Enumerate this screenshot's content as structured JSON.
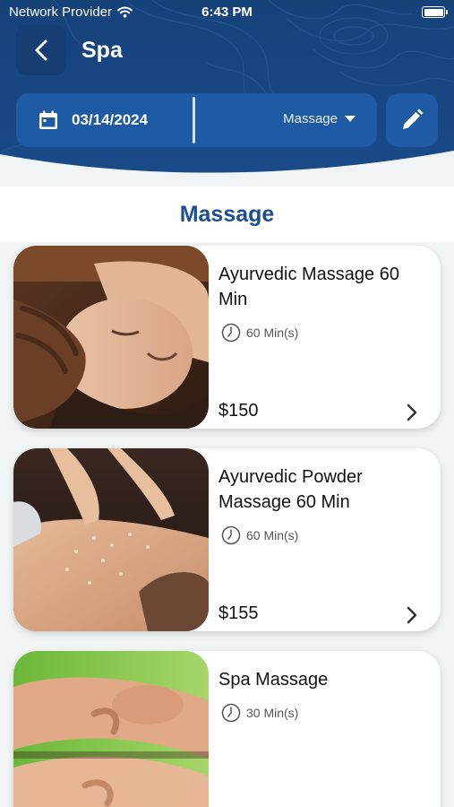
{
  "status_bar": {
    "carrier": "Network Provider",
    "time": "6:43 PM"
  },
  "header": {
    "title": "Spa"
  },
  "filter": {
    "date": "03/14/2024",
    "category": "Massage"
  },
  "section": {
    "title": "Massage"
  },
  "services": [
    {
      "name": "Ayurvedic Massage 60 Min",
      "duration": "60 Min(s)",
      "price": "$150",
      "image": "face-massage-photo"
    },
    {
      "name": "Ayurvedic Powder Massage 60 Min",
      "duration": "60 Min(s)",
      "price": "$155",
      "image": "back-massage-photo"
    },
    {
      "name": "Spa Massage",
      "duration": "30 Min(s)",
      "image": "couple-massage-photo"
    }
  ],
  "colors": {
    "header": "#1a4b8a",
    "accent": "#1f5aa5",
    "section_title": "#1b4f8f"
  },
  "icons": [
    "wifi-icon",
    "battery-icon",
    "back-arrow-icon",
    "calendar-icon",
    "dropdown-caret-icon",
    "edit-pencil-icon",
    "clock-icon",
    "chevron-right-icon"
  ]
}
